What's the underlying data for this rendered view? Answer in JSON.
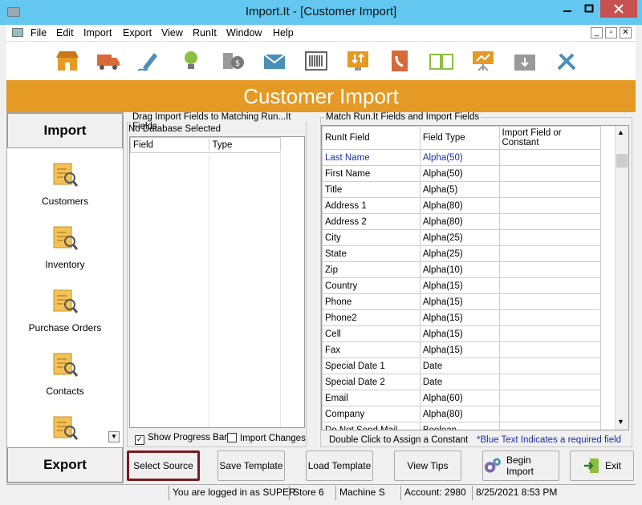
{
  "window": {
    "title": "Import.It - [Customer Import]"
  },
  "menu": [
    "File",
    "Edit",
    "Import",
    "Export",
    "View",
    "RunIt",
    "Window",
    "Help"
  ],
  "toolbar_icons": [
    "store-icon",
    "truck-icon",
    "pen-icon",
    "lightbulb-icon",
    "coins-icon",
    "mail-icon",
    "barcode-icon",
    "transfer-icon",
    "phonebook-icon",
    "book-icon",
    "presentation-icon",
    "archive-icon",
    "tools-icon"
  ],
  "banner": "Customer Import",
  "left": {
    "import_label": "Import",
    "export_label": "Export",
    "items": [
      "Customers",
      "Inventory",
      "Purchase Orders",
      "Contacts"
    ]
  },
  "drag_panel": {
    "legend": "Drag Import Fields to Matching Run...It Fields",
    "db_status": "No Database Selected",
    "headers": [
      "Field",
      "Type"
    ],
    "show_progress_label": "Show Progress Bar",
    "show_progress_checked": true,
    "import_changes_label": "Import Changes",
    "import_changes_checked": false
  },
  "match_panel": {
    "legend": "Match Run.It Fields and Import Fields",
    "headers": [
      "RunIt Field",
      "Field Type",
      "Import Field or Constant"
    ],
    "rows": [
      {
        "field": "Last Name",
        "type": "Alpha(50)",
        "required": true
      },
      {
        "field": "First Name",
        "type": "Alpha(50)",
        "required": false
      },
      {
        "field": "Title",
        "type": "Alpha(5)",
        "required": false
      },
      {
        "field": "Address 1",
        "type": "Alpha(80)",
        "required": false
      },
      {
        "field": "Address 2",
        "type": "Alpha(80)",
        "required": false
      },
      {
        "field": "City",
        "type": "Alpha(25)",
        "required": false
      },
      {
        "field": "State",
        "type": "Alpha(25)",
        "required": false
      },
      {
        "field": "Zip",
        "type": "Alpha(10)",
        "required": false
      },
      {
        "field": "Country",
        "type": "Alpha(15)",
        "required": false
      },
      {
        "field": "Phone",
        "type": "Alpha(15)",
        "required": false
      },
      {
        "field": "Phone2",
        "type": "Alpha(15)",
        "required": false
      },
      {
        "field": "Cell",
        "type": "Alpha(15)",
        "required": false
      },
      {
        "field": "Fax",
        "type": "Alpha(15)",
        "required": false
      },
      {
        "field": "Special Date 1",
        "type": "Date",
        "required": false
      },
      {
        "field": "Special Date 2",
        "type": "Date",
        "required": false
      },
      {
        "field": "Email",
        "type": "Alpha(60)",
        "required": false
      },
      {
        "field": "Company",
        "type": "Alpha(80)",
        "required": false
      },
      {
        "field": "Do Not Send Mail",
        "type": "Boolean",
        "required": false
      }
    ],
    "hint_left": "Double Click to Assign a Constant",
    "hint_right": "*Blue Text Indicates a required field"
  },
  "buttons": {
    "select_source": "Select Source",
    "save_template": "Save Template",
    "load_template": "Load Template",
    "view_tips": "View Tips",
    "begin_import": "Begin Import",
    "exit": "Exit"
  },
  "status": {
    "user": "You are logged in as SUPER",
    "store": "Store 6",
    "machine": "Machine S",
    "account": "Account: 2980",
    "datetime": "8/25/2021 8:53 PM"
  },
  "colors": {
    "banner": "#e49a24",
    "titlebar": "#63c7f0",
    "required_text": "#1a2fa0",
    "highlight_border": "#7a1a22"
  }
}
